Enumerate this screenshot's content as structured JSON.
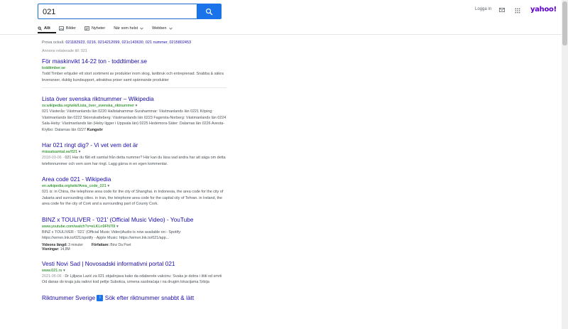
{
  "search": {
    "value": "021",
    "button_icon": "search-icon"
  },
  "header": {
    "signin": "Logga in",
    "mail_icon": "mail-icon",
    "apps_icon": "apps-icon",
    "logo": "yahoo!"
  },
  "tabs": [
    {
      "label": "Allt",
      "icon": "search-icon"
    },
    {
      "label": "Bilder",
      "icon": "image-icon"
    },
    {
      "label": "Nyheter",
      "icon": "news-icon"
    },
    {
      "label": "När som helst",
      "icon": "chevron-down-icon"
    },
    {
      "label": "Webben",
      "icon": "chevron-down-icon"
    }
  ],
  "also_try": {
    "prefix": "Prova också:",
    "items": [
      "021182923",
      "0216",
      "0214212099",
      "021c143630",
      "021 nummer",
      "0215802453"
    ]
  },
  "ads_label": "Annons relaterade till: 021",
  "results": [
    {
      "title": "För maskinvikt 14-22 ton - toddtimber.se",
      "url": "toddtimber.se",
      "snippet": "Todd Timber erbjuder ett stort sortiment av produkter inom skog, lantbruk och entreprenad. Snabba & säkra leveranser, duktig kundsupport, attraktiva priser samt spännande produkter"
    },
    {
      "title": "Lista över svenska riktnummer – Wikipedia",
      "url": "sv.wikipedia.org/wiki/Lista_över_svenska_riktnummer",
      "snippet": "021 Västerås: Västmanlands län 0220 Hallstahammar-Surahammar: Västmanlands län 0221 Köping: Västmanlands län 0222 Skinnskatteberg: Västmanlands län 0223 Fagersta-Norberg: Västmanlands län 0224 Sala-Heby: Västmanlands län (Heby ligger i Uppsala län) 0225 Hedemora-Säter: Dalarnas län 0226 Avesta-Krylbo: Dalarnas län 0227",
      "snippet_bold": "Kungsör"
    },
    {
      "title": "Har 021 ringt dig? - Vi vet vem det är",
      "url": "missatsamtal.se/021",
      "date": "2018-03-06 ·",
      "snippet": "021 Har du fått ett samtal från detta nummer? Här kan du läsa vad andra har att säga om detta telefonnummer och vem som har ringt. Lagg gärna in en egen kommentar."
    },
    {
      "title": "Area code 021 - Wikipedia",
      "url": "en.wikipedia.org/wiki/Area_code_021",
      "snippet": "021 is: in China, the telephone area code for the city of Shanghai. in Indonesia, the area code for the city of Jakarta and surrounding cities. in Iran, the telephone area code for the capital city of Tehran. in Ireland, the area code for the city of Cork and a surrounding part of County Cork."
    },
    {
      "title": "BINZ x TOULIVER - '021' (Official Music Video) - YouTube",
      "url": "www.youtube.com/watch?v=eLKLn9FN70I",
      "snippet": "BINZ x TOULIVER - '021' (Official Music Video)Audio is now available on:- Spotify: https://wmvn.lnk.to/021/spotify - Apple Music: https://wmvn.lnk.to/021/app...",
      "video_length_label": "Videons längd:",
      "video_length": "3 minuter",
      "author_label": "Författare:",
      "author": "Binz Da Poet",
      "views_label": "Visningar:",
      "views": "14,8M"
    },
    {
      "title": "Vesti Novi Sad | Novosadski informativni portal 021",
      "url": "www.021.rs",
      "date": "2021-05-06 ·",
      "snippet": "Dr Ljiljana Lazić za 021 objašnjava kako da odaberete vakcinu: Svaka je dobra i štiti od smrti Od danas do kraja jula radovi kod petlje Subotica, izmena saobraćaja i na drugim lokacijama Srbija"
    },
    {
      "title": "Riktnummer Sverige",
      "badge": "i",
      "title_rest": "Sök efter riktnummer snabbt & lätt"
    }
  ]
}
